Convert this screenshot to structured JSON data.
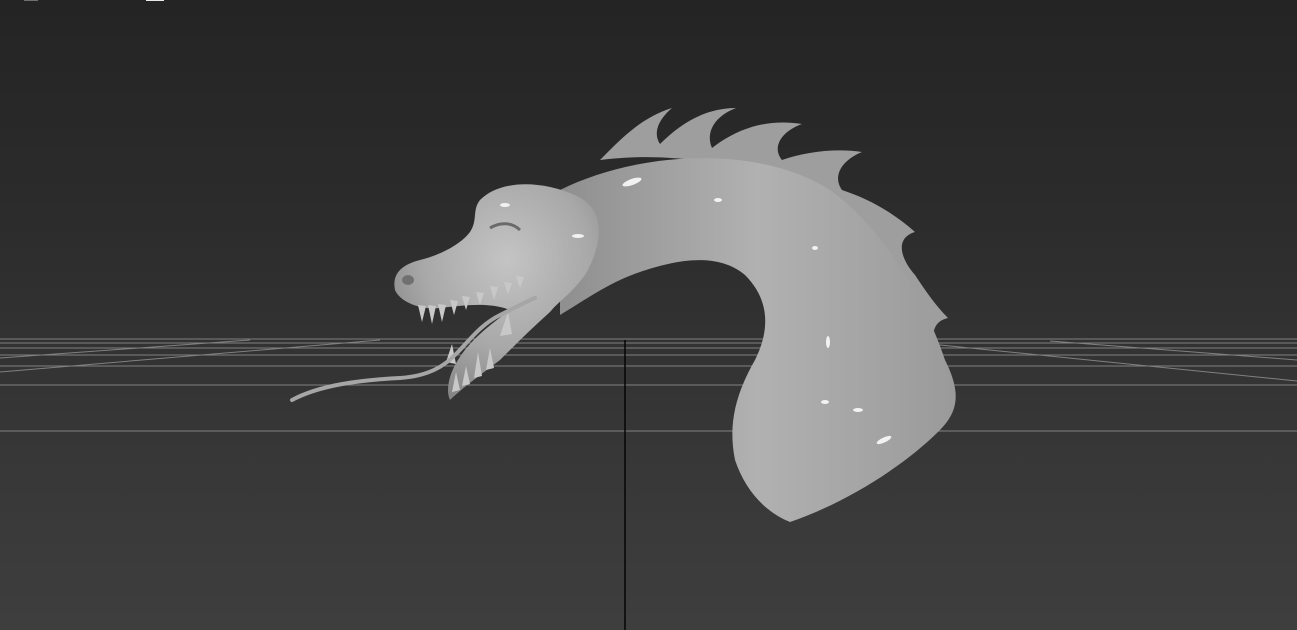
{
  "viewport": {
    "label_marks": [
      "",
      ""
    ],
    "background_top": "#242424",
    "background_bottom": "#3e3e3e",
    "grid_color": "#9a9a9a",
    "axis_color": "#050505",
    "model_color": "#a9a9a9"
  },
  "model": {
    "name": "dragon-head",
    "material": "gray-clay"
  }
}
